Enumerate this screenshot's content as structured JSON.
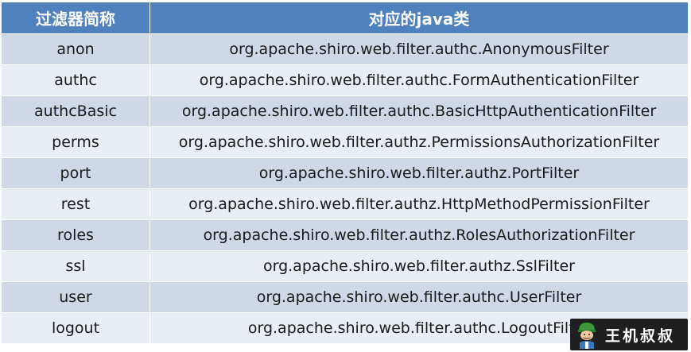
{
  "table": {
    "headers": [
      "过滤器简称",
      "对应的java类"
    ],
    "rows": [
      {
        "name": "anon",
        "class": "org.apache.shiro.web.filter.authc.AnonymousFilter"
      },
      {
        "name": "authc",
        "class": "org.apache.shiro.web.filter.authc.FormAuthenticationFilter"
      },
      {
        "name": "authcBasic",
        "class": "org.apache.shiro.web.filter.authc.BasicHttpAuthenticationFilter"
      },
      {
        "name": "perms",
        "class": "org.apache.shiro.web.filter.authz.PermissionsAuthorizationFilter"
      },
      {
        "name": "port",
        "class": "org.apache.shiro.web.filter.authz.PortFilter"
      },
      {
        "name": "rest",
        "class": "org.apache.shiro.web.filter.authz.HttpMethodPermissionFilter"
      },
      {
        "name": "roles",
        "class": "org.apache.shiro.web.filter.authz.RolesAuthorizationFilter"
      },
      {
        "name": "ssl",
        "class": "org.apache.shiro.web.filter.authz.SslFilter"
      },
      {
        "name": "user",
        "class": "org.apache.shiro.web.filter.authc.UserFilter"
      },
      {
        "name": "logout",
        "class": "org.apache.shiro.web.filter.authc.LogoutFilter"
      }
    ]
  },
  "watermark": {
    "text": "王机叔叔",
    "icon": "avatar-icon"
  },
  "colors": {
    "header_bg": "#4f81bd",
    "row_odd_bg": "#d0d8e8",
    "row_even_bg": "#e9edf4",
    "watermark_bg": "#1f1f1f"
  }
}
